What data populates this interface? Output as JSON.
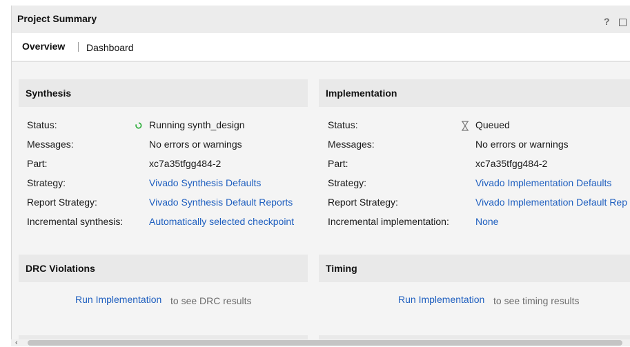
{
  "panel": {
    "title": "Project Summary",
    "help_glyph": "?"
  },
  "tabs": [
    {
      "label": "Overview",
      "active": true
    },
    {
      "label": "Dashboard",
      "active": false
    }
  ],
  "synthesis": {
    "header": "Synthesis",
    "rows": [
      {
        "label": "Status:",
        "value": "Running synth_design",
        "icon": "spinner-icon"
      },
      {
        "label": "Messages:",
        "value": "No errors or warnings"
      },
      {
        "label": "Part:",
        "value": "xc7a35tfgg484-2"
      },
      {
        "label": "Strategy:",
        "value": "Vivado Synthesis Defaults",
        "link": true
      },
      {
        "label": "Report Strategy:",
        "value": "Vivado Synthesis Default Reports",
        "link": true
      },
      {
        "label": "Incremental synthesis:",
        "value": "Automatically selected checkpoint",
        "link": true
      }
    ]
  },
  "implementation": {
    "header": "Implementation",
    "rows": [
      {
        "label": "Status:",
        "value": "Queued",
        "icon": "hourglass-icon"
      },
      {
        "label": "Messages:",
        "value": "No errors or warnings"
      },
      {
        "label": "Part:",
        "value": "xc7a35tfgg484-2"
      },
      {
        "label": "Strategy:",
        "value": "Vivado Implementation Defaults",
        "link": true
      },
      {
        "label": "Report Strategy:",
        "value": "Vivado Implementation Default Rep",
        "link": true
      },
      {
        "label": "Incremental implementation:",
        "value": "None",
        "link": true
      }
    ]
  },
  "drc": {
    "header": "DRC Violations",
    "link": "Run Implementation",
    "hint": "to see DRC results"
  },
  "timing": {
    "header": "Timing",
    "link": "Run Implementation",
    "hint": "to see timing results"
  },
  "colors": {
    "link": "#1f5fbf",
    "spinner": "#2fae3c",
    "header_bg": "#e9e9e9",
    "panel_bg": "#f4f4f4"
  },
  "scrollbar": {
    "left_arrow": "‹"
  }
}
